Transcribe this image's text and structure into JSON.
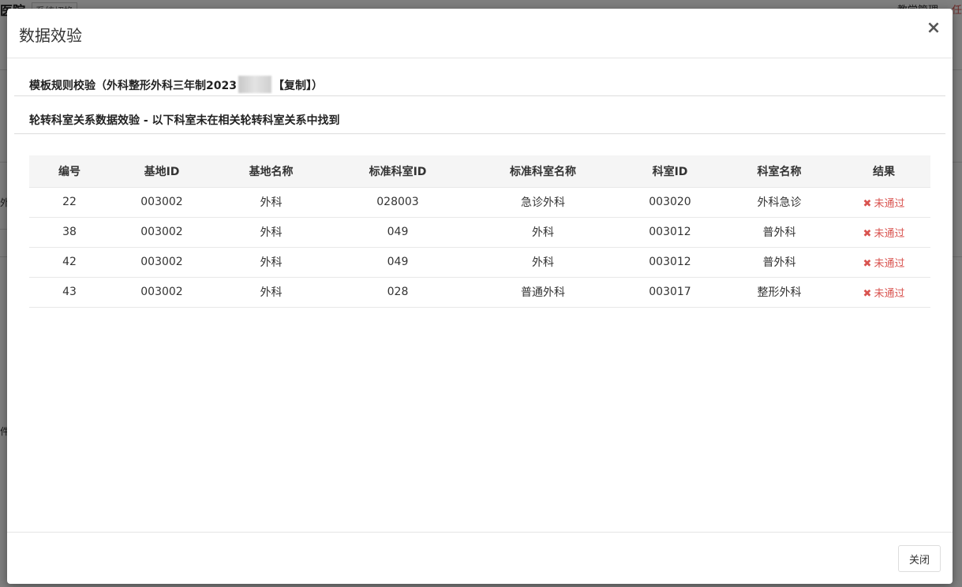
{
  "background": {
    "left_title": "医院",
    "top_tab": "系统切换",
    "top_right": "教学管理",
    "top_right_edge": "任",
    "side_texts": [
      "外",
      "件"
    ]
  },
  "modal": {
    "title": "数据效验",
    "close_symbol": "×",
    "template_check_prefix": "模板规则校验（外科整形外科三年制2023",
    "template_check_suffix": "【复制】）",
    "relation_check": "轮转科室关系数据效验 - 以下科室未在相关轮转科室关系中找到",
    "table": {
      "headers": [
        "编号",
        "基地ID",
        "基地名称",
        "标准科室ID",
        "标准科室名称",
        "科室ID",
        "科室名称",
        "结果"
      ],
      "rows": [
        {
          "no": "22",
          "base_id": "003002",
          "base_name": "外科",
          "std_dept_id": "028003",
          "std_dept_name": "急诊外科",
          "dept_id": "003020",
          "dept_name": "外科急诊",
          "result": "未通过"
        },
        {
          "no": "38",
          "base_id": "003002",
          "base_name": "外科",
          "std_dept_id": "049",
          "std_dept_name": "外科",
          "dept_id": "003012",
          "dept_name": "普外科",
          "result": "未通过"
        },
        {
          "no": "42",
          "base_id": "003002",
          "base_name": "外科",
          "std_dept_id": "049",
          "std_dept_name": "外科",
          "dept_id": "003012",
          "dept_name": "普外科",
          "result": "未通过"
        },
        {
          "no": "43",
          "base_id": "003002",
          "base_name": "外科",
          "std_dept_id": "028",
          "std_dept_name": "普通外科",
          "dept_id": "003017",
          "dept_name": "整形外科",
          "result": "未通过"
        }
      ]
    },
    "fail_icon": "✖",
    "footer_close_label": "关闭"
  },
  "colors": {
    "fail": "#d9534f",
    "header_bg": "#f5f5f5"
  }
}
